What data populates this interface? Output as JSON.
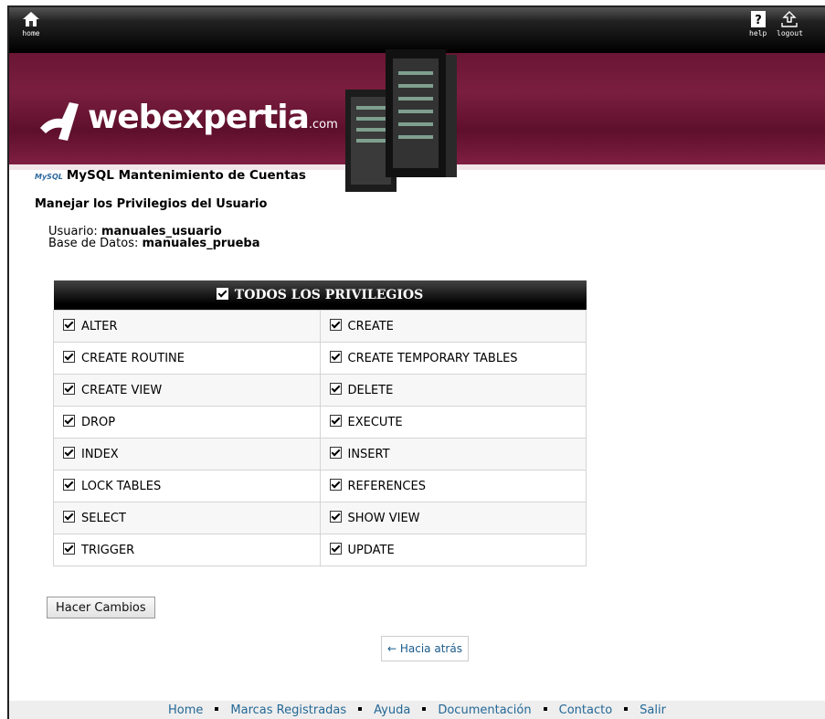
{
  "topbar": {
    "home_label": "home",
    "help_label": "help",
    "logout_label": "logout"
  },
  "brand": {
    "logo_text": "webexpertia",
    "logo_suffix": ".com"
  },
  "page": {
    "app_title": "MySQL Mantenimiento de Cuentas",
    "mysql_logo_text": "MySQL",
    "section_title": "Manejar los Privilegios del Usuario",
    "user_label": "Usuario:",
    "user_value": "manuales_usuario",
    "db_label": "Base de Datos:",
    "db_value": "manuales_prueba"
  },
  "privileges": {
    "header": "TODOS LOS PRIVILEGIOS",
    "rows": [
      [
        "ALTER",
        "CREATE"
      ],
      [
        "CREATE ROUTINE",
        "CREATE TEMPORARY TABLES"
      ],
      [
        "CREATE VIEW",
        "DELETE"
      ],
      [
        "DROP",
        "EXECUTE"
      ],
      [
        "INDEX",
        "INSERT"
      ],
      [
        "LOCK TABLES",
        "REFERENCES"
      ],
      [
        "SELECT",
        "SHOW VIEW"
      ],
      [
        "TRIGGER",
        "UPDATE"
      ]
    ]
  },
  "actions": {
    "submit_label": "Hacer Cambios",
    "back_label": "← Hacia atrás"
  },
  "footer": {
    "links": [
      "Home",
      "Marcas Registradas",
      "Ayuda",
      "Documentación",
      "Contacto",
      "Salir"
    ]
  },
  "colors": {
    "banner": "#6a1534",
    "link": "#246896",
    "header_bg": "#000000"
  }
}
